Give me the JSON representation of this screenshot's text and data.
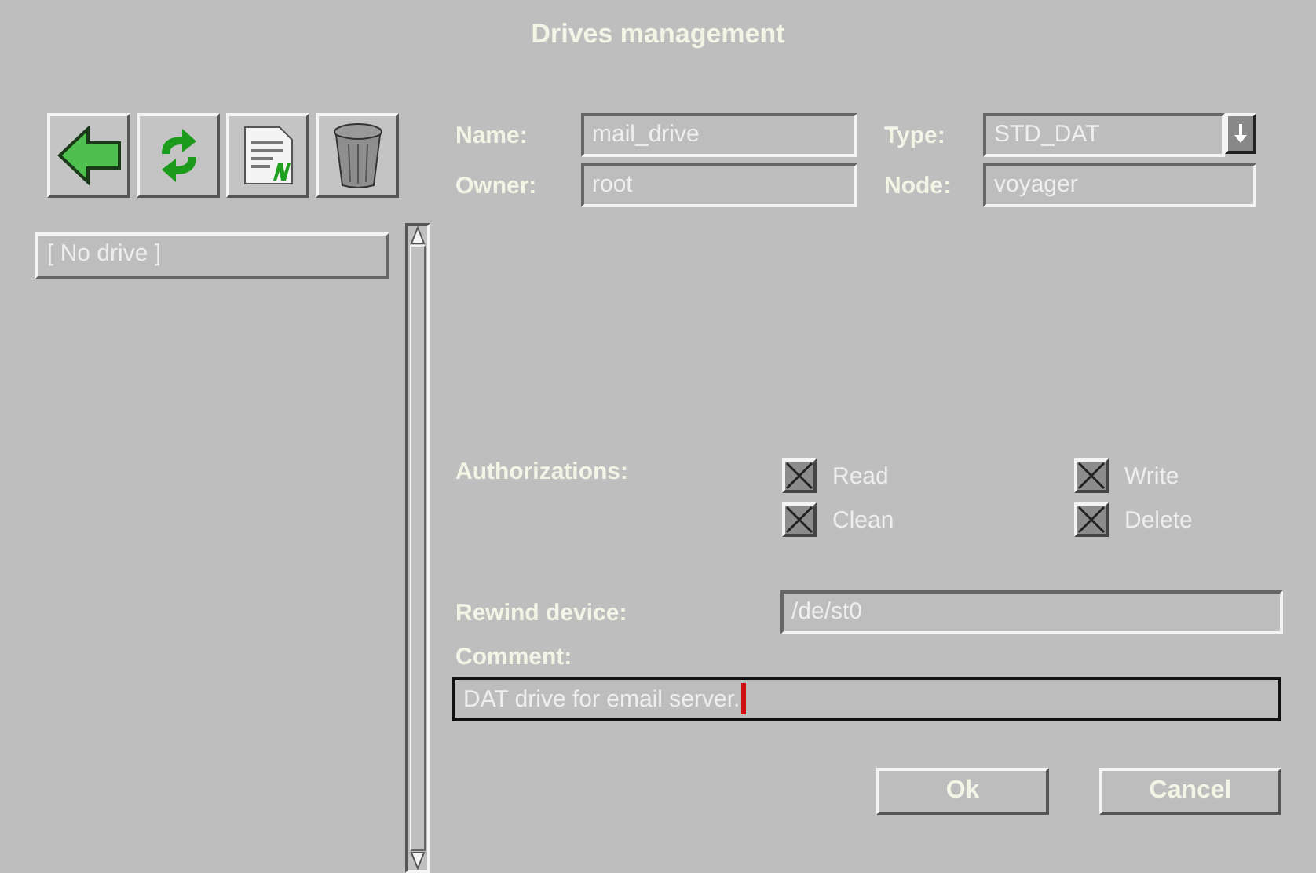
{
  "window": {
    "title": "Drives management"
  },
  "toolbar": [
    {
      "kind": "back"
    },
    {
      "kind": "refresh"
    },
    {
      "kind": "new"
    },
    {
      "kind": "delete"
    }
  ],
  "drive_list": {
    "items": [
      {
        "label": "[ No drive ]",
        "selected": false
      }
    ]
  },
  "form": {
    "name": {
      "label": "Name:",
      "value": "mail_drive"
    },
    "type": {
      "label": "Type:",
      "value": "STD_DAT"
    },
    "owner": {
      "label": "Owner:",
      "value": "root"
    },
    "node": {
      "label": "Node:",
      "value": "voyager"
    },
    "authorizations": {
      "label": "Authorizations:",
      "options": [
        {
          "label": "Read",
          "checked": true
        },
        {
          "label": "Write",
          "checked": true
        },
        {
          "label": "Clean",
          "checked": true
        },
        {
          "label": "Delete",
          "checked": true
        }
      ]
    },
    "rewind_device": {
      "label": "Rewind device:",
      "value": "/de/st0"
    },
    "comment": {
      "label": "Comment:",
      "value": "DAT drive for email server.",
      "focused": true
    }
  },
  "buttons": [
    {
      "label": "Ok"
    },
    {
      "label": "Cancel"
    }
  ]
}
